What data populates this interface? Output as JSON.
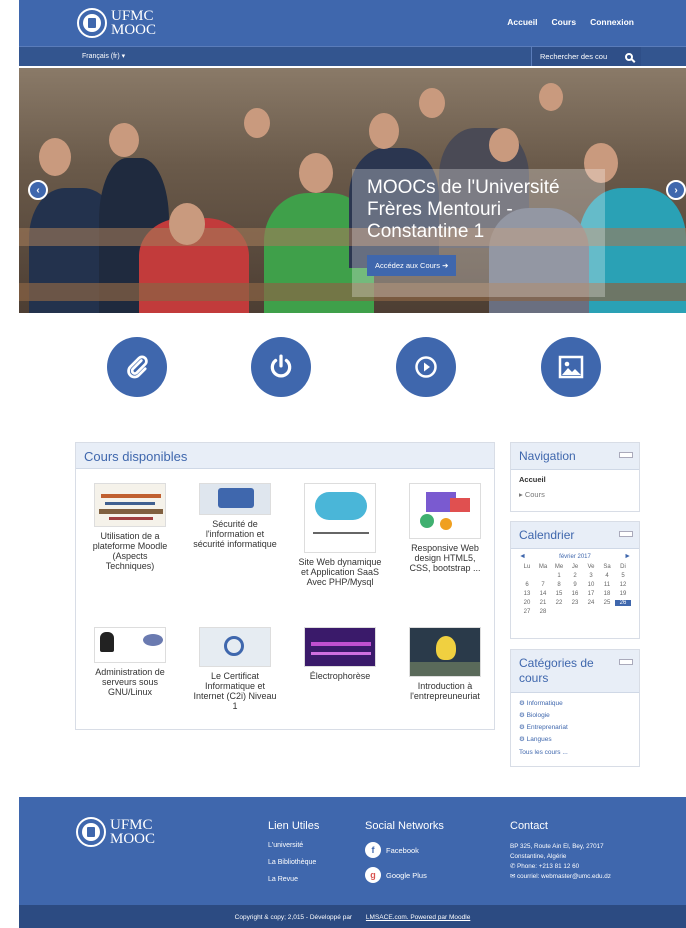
{
  "header": {
    "logo_line1": "UFMC",
    "logo_line2": "MOOC",
    "nav": [
      "Accueil",
      "Cours",
      "Connexion"
    ],
    "language": "Français (fr) ▾",
    "search_text": "Rechercher des cou"
  },
  "hero": {
    "title": "MOOCs de l'Université Frères Mentouri - Constantine 1",
    "button": "Accédez aux Cours ➔",
    "prev": "‹",
    "next": "›"
  },
  "features": [
    "paperclip-icon",
    "power-icon",
    "play-icon",
    "image-icon"
  ],
  "courses": {
    "title": "Cours disponibles",
    "items": [
      "Utilisation de a plateforme Moodle (Aspects Techniques)",
      "Sécurité de l'information et sécurité informatique",
      "Site Web dynamique et Application SaaS Avec PHP/Mysql",
      "Responsive Web design HTML5, CSS, bootstrap ...",
      "Administration de serveurs sous GNU/Linux",
      "Le Certificat Informatique et Internet (C2i) Niveau 1",
      "Électrophorèse",
      "Introduction à l'entrepreuneuriat"
    ]
  },
  "navigation": {
    "title": "Navigation",
    "home": "Accueil",
    "item": "▸ Cours"
  },
  "calendar": {
    "title": "Calendrier",
    "month": "février 2017",
    "days": [
      "Lu",
      "Ma",
      "Me",
      "Je",
      "Ve",
      "Sa",
      "Di"
    ],
    "dates": [
      "",
      "",
      "1",
      "2",
      "3",
      "4",
      "5",
      "6",
      "7",
      "8",
      "9",
      "10",
      "11",
      "12",
      "13",
      "14",
      "15",
      "16",
      "17",
      "18",
      "19",
      "20",
      "21",
      "22",
      "23",
      "24",
      "25",
      "26",
      "27",
      "28"
    ],
    "today": "26"
  },
  "categories": {
    "title": "Catégories de cours",
    "items": [
      "Informatique",
      "Biologie",
      "Entreprenariat",
      "Langues"
    ],
    "all": "Tous les cours ..."
  },
  "footer": {
    "useful_title": "Lien Utiles",
    "useful": [
      "L'université",
      "La Bibliothèque",
      "La Revue"
    ],
    "social_title": "Social Networks",
    "facebook": "Facebook",
    "google": "Google Plus",
    "contact_title": "Contact",
    "address": "BP 325, Route Ain El, Bey, 27017",
    "city": "Constantine, Algérie",
    "phone": "Phone: +213 81 12 60",
    "email": "courriel: webmaster@umc.edu.dz",
    "copyright": "Copyright & copy; 2,015 - Développé par",
    "credits": "LMSACE.com. Powered par Moodle"
  },
  "colors": {
    "brand": "#3f67ad",
    "dark": "#2c4b82"
  }
}
